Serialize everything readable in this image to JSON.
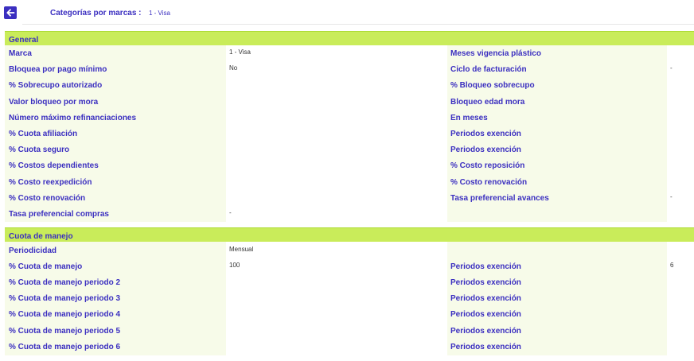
{
  "header": {
    "title": "Categorías por marcas :",
    "value": "1 -  Visa"
  },
  "general": {
    "title": "General",
    "left": [
      {
        "label": "Marca",
        "value": "1 - Visa"
      },
      {
        "label": "Bloquea por pago mínimo",
        "value": "No"
      },
      {
        "label": "% Sobrecupo autorizado",
        "value": ""
      },
      {
        "label": "Valor bloqueo por mora",
        "value": ""
      },
      {
        "label": "Número máximo refinanciaciones",
        "value": ""
      },
      {
        "label": "% Cuota afiliación",
        "value": ""
      },
      {
        "label": "% Cuota seguro",
        "value": ""
      },
      {
        "label": "% Costos dependientes",
        "value": ""
      },
      {
        "label": "% Costo reexpedición",
        "value": ""
      },
      {
        "label": "% Costo renovación",
        "value": ""
      },
      {
        "label": "Tasa preferencial compras",
        "value": "-"
      }
    ],
    "right": [
      {
        "label": "Meses vigencia plástico",
        "value": ""
      },
      {
        "label": "Ciclo de facturación",
        "value": "-"
      },
      {
        "label": "% Bloqueo sobrecupo",
        "value": ""
      },
      {
        "label": "Bloqueo edad mora",
        "value": ""
      },
      {
        "label": "En meses",
        "value": ""
      },
      {
        "label": "Periodos exención",
        "value": ""
      },
      {
        "label": "Periodos exención",
        "value": ""
      },
      {
        "label": "% Costo reposición",
        "value": ""
      },
      {
        "label": "% Costo renovación",
        "value": ""
      },
      {
        "label": "Tasa preferencial avances",
        "value": "-"
      }
    ]
  },
  "cuota": {
    "title": "Cuota de manejo",
    "left": [
      {
        "label": "Periodicidad",
        "value": "Mensual"
      },
      {
        "label": "% Cuota de manejo",
        "value": "100"
      },
      {
        "label": "% Cuota de manejo periodo 2",
        "value": ""
      },
      {
        "label": "% Cuota de manejo periodo 3",
        "value": ""
      },
      {
        "label": "% Cuota de manejo periodo 4",
        "value": ""
      },
      {
        "label": "% Cuota de manejo periodo 5",
        "value": ""
      },
      {
        "label": "% Cuota de manejo periodo 6",
        "value": ""
      }
    ],
    "right": [
      {
        "label": "",
        "value": ""
      },
      {
        "label": "Periodos exención",
        "value": "6"
      },
      {
        "label": "Periodos exención",
        "value": ""
      },
      {
        "label": "Periodos exención",
        "value": ""
      },
      {
        "label": "Periodos exención",
        "value": ""
      },
      {
        "label": "Periodos exención",
        "value": ""
      },
      {
        "label": "Periodos exención",
        "value": ""
      }
    ]
  }
}
